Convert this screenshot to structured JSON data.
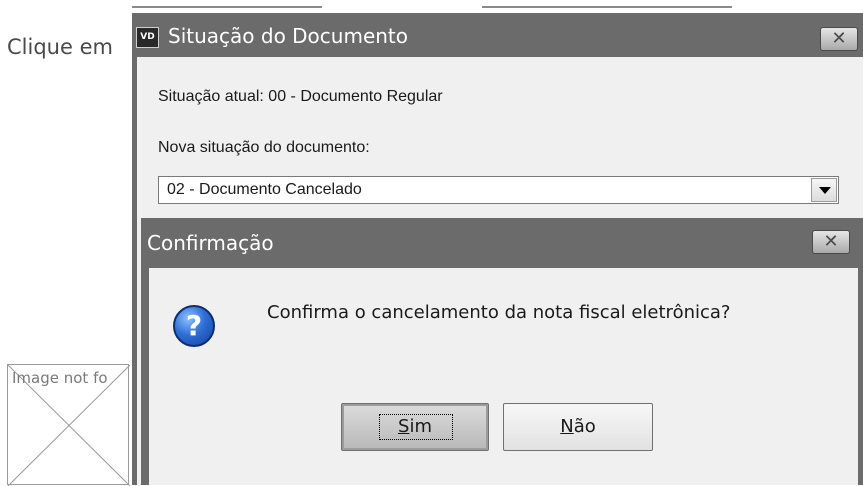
{
  "background": {
    "instruction_text": "Clique em",
    "broken_image_alt": "Image not fo"
  },
  "main_window": {
    "app_icon_text": "VD",
    "title": "Situação do Documento",
    "close_glyph": "✕",
    "current_status": "Situação atual: 00 - Documento Regular",
    "new_status_label": "Nova situação do documento:",
    "new_status_selected": "02 - Documento Cancelado"
  },
  "confirm_dialog": {
    "title": "Confirmação",
    "close_glyph": "✕",
    "icon": "question-icon",
    "icon_glyph": "?",
    "message": "Confirma o cancelamento da nota fiscal eletrônica?",
    "buttons": {
      "yes": {
        "mnemonic": "S",
        "rest": "im"
      },
      "no": {
        "mnemonic": "N",
        "rest": "ão"
      }
    }
  },
  "colors": {
    "titlebar": "#6b6b6b",
    "body": "#f0f0f0",
    "icon_blue": "#2f6fd6"
  }
}
